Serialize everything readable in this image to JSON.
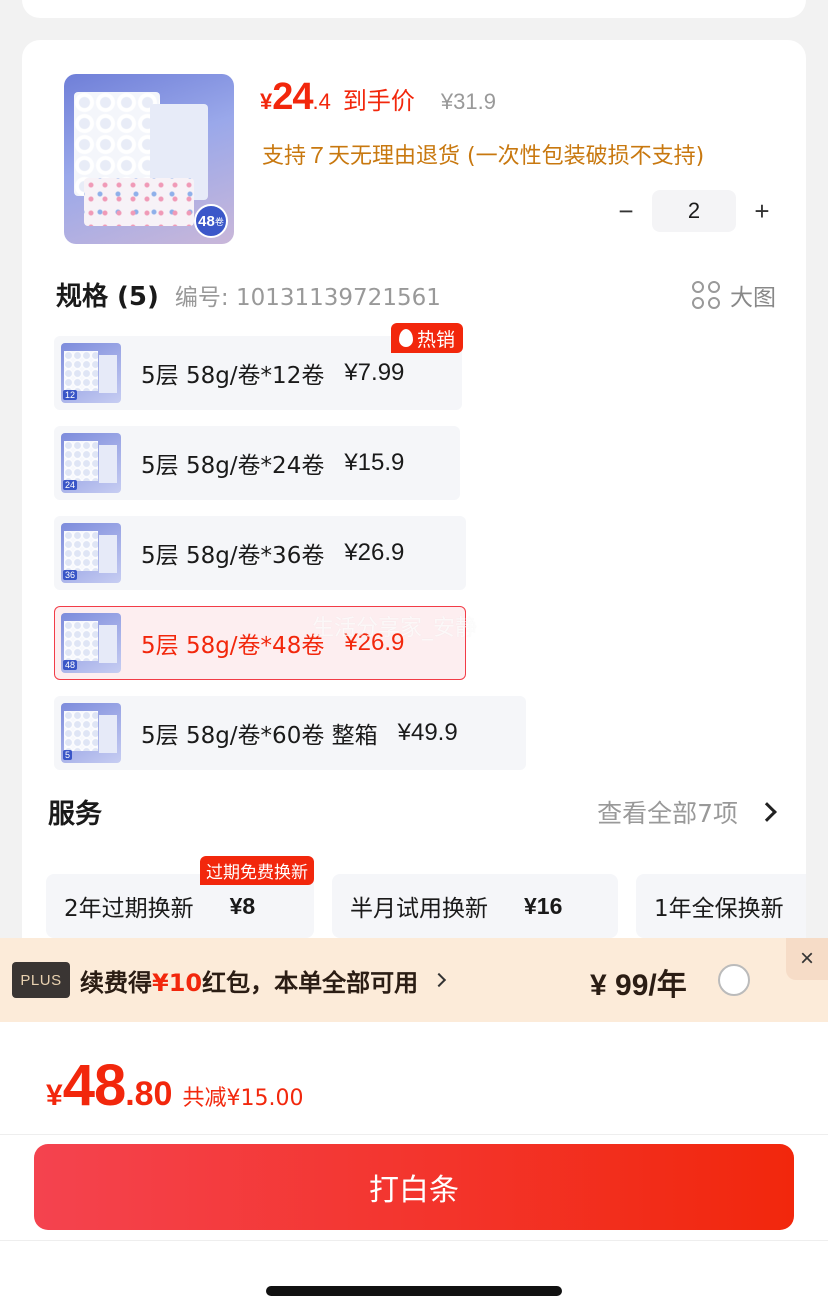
{
  "product": {
    "thumb_badge_num": "48",
    "thumb_badge_unit": "卷",
    "price_yen": "¥",
    "price_int": "24",
    "price_dec": ".4",
    "price_label": "到手价",
    "original_price": "¥31.9",
    "return_note": "支持７天无理由退货 (一次性包装破损不支持)",
    "quantity": "2",
    "minus": "−",
    "plus": "+"
  },
  "spec": {
    "title": "规格 (5)",
    "code": "编号: 10131139721561",
    "big_image_label": "大图",
    "options": [
      {
        "text": "5层 58g/卷*12卷",
        "price": "¥7.99",
        "tag": "12",
        "badge": "热销",
        "selected": false
      },
      {
        "text": "5层 58g/卷*24卷",
        "price": "¥15.9",
        "tag": "24",
        "badge": "",
        "selected": false
      },
      {
        "text": "5层 58g/卷*36卷",
        "price": "¥26.9",
        "tag": "36",
        "badge": "",
        "selected": false
      },
      {
        "text": "5层 58g/卷*48卷",
        "price": "¥26.9",
        "tag": "48",
        "badge": "",
        "selected": true
      },
      {
        "text": "5层 58g/卷*60卷 整箱",
        "price": "¥49.9",
        "tag": "5",
        "badge": "",
        "selected": false
      }
    ]
  },
  "watermark": "生活分享家_安静",
  "service": {
    "title": "服务",
    "view_all": "查看全部7项",
    "items": [
      {
        "name": "2年过期换新",
        "price": "¥8",
        "badge": "过期免费换新"
      },
      {
        "name": "半月试用换新",
        "price": "¥16",
        "badge": ""
      },
      {
        "name": "1年全保换新",
        "price": "",
        "badge": ""
      }
    ]
  },
  "plus": {
    "logo": "PLUS",
    "text_before": "续费得",
    "text_highlight": "¥10",
    "text_after": "红包，本单全部可用",
    "price": "¥ 99/年",
    "close": "×"
  },
  "checkout": {
    "total_yen": "¥",
    "total_int": "48",
    "total_dec": ".80",
    "total_save": "共减¥15.00",
    "pay_label": "打白条"
  }
}
